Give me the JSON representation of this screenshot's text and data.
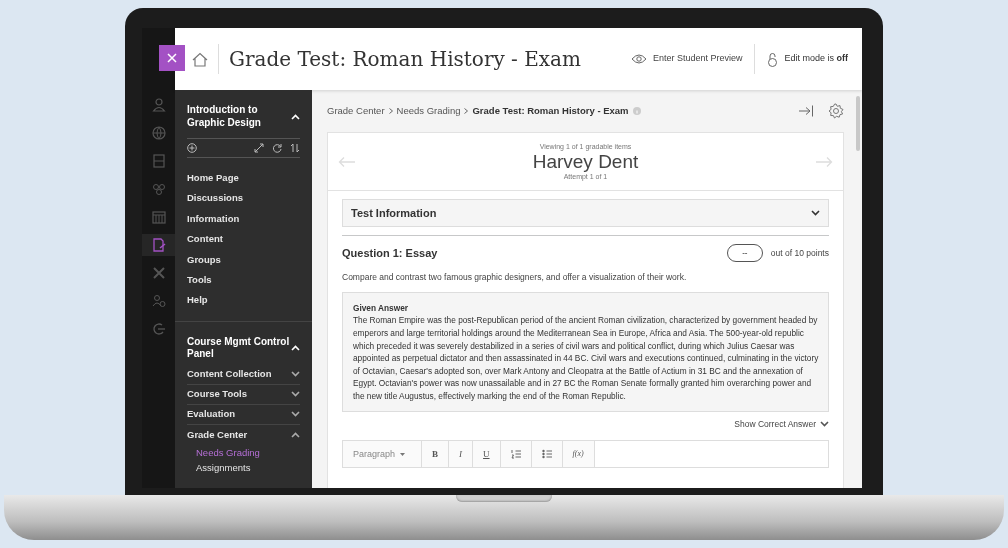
{
  "header": {
    "title": "Grade Test: Roman History - Exam",
    "preview_label": "Enter Student Preview",
    "edit_mode": "Edit mode is **off**"
  },
  "rail_icons": [
    {
      "selected": false
    },
    {
      "selected": false
    },
    {
      "selected": false
    },
    {
      "selected": false
    },
    {
      "selected": false
    },
    {
      "selected": true
    },
    {
      "selected": false
    },
    {
      "selected": false
    },
    {
      "selected": false
    }
  ],
  "course_menu": {
    "title": "Introduction to Graphic Design",
    "expanded": true,
    "items": [
      "Home Page",
      "Discussions",
      "Information",
      "Content",
      "Groups",
      "Tools",
      "Help"
    ]
  },
  "control_panel": {
    "title": "Course Mgmt Control Panel",
    "expanded": true,
    "items": [
      {
        "label": "Content Collection",
        "expanded": false
      },
      {
        "label": "Course Tools",
        "expanded": false
      },
      {
        "label": "Evaluation",
        "expanded": false
      },
      {
        "label": "Grade Center",
        "expanded": true,
        "children": [
          {
            "label": "Needs Grading",
            "selected": true
          },
          {
            "label": "Assignments",
            "selected": false
          }
        ]
      }
    ]
  },
  "breadcrumb": [
    "Grade Center",
    "Needs Grading",
    "Grade Test: Roman History - Exam"
  ],
  "student": {
    "viewing": "Viewing 1 of 1 gradable items",
    "name": "Harvey Dent",
    "attempt": "Attempt 1 of 1"
  },
  "test_information": {
    "label": "Test Information",
    "expanded": false
  },
  "question": {
    "title": "Question 1: Essay",
    "score": "--",
    "out_of": "out of 10 points",
    "prompt": "Compare and contrast two famous graphic designers, and offer a visualization of their work.",
    "answer_label": "Given Answer",
    "answer": "The Roman Empire was the post-Republican period of the ancient Roman civilization, characterized by government headed by emperors and large territorial holdings around the Mediterranean Sea in Europe, Africa and Asia. The 500-year-old republic which preceded it was severely destabilized in a series of civil wars and political conflict, during which Julius Caesar was appointed as perpetual dictator and then assassinated in 44 BC. Civil wars and executions continued, culminating in the victory of Octavian, Caesar's adopted son, over Mark Antony and Cleopatra at the Battle of Actium in 31 BC and the annexation of Egypt. Octavian's power was now unassailable and in 27 BC the Roman Senate formally granted him overarching power and the new title Augustus, effectively marking the end of the Roman Republic.",
    "show_correct": "Show Correct Answer"
  },
  "editor_toolbar": [
    {
      "kind": "dropdown",
      "label": "Paragraph"
    },
    {
      "kind": "bold",
      "label": "B"
    },
    {
      "kind": "italic",
      "label": "I"
    },
    {
      "kind": "underline",
      "label": "U"
    },
    {
      "kind": "numbered-list"
    },
    {
      "kind": "bulleted-list"
    },
    {
      "kind": "formula",
      "label": "f(x)"
    }
  ]
}
